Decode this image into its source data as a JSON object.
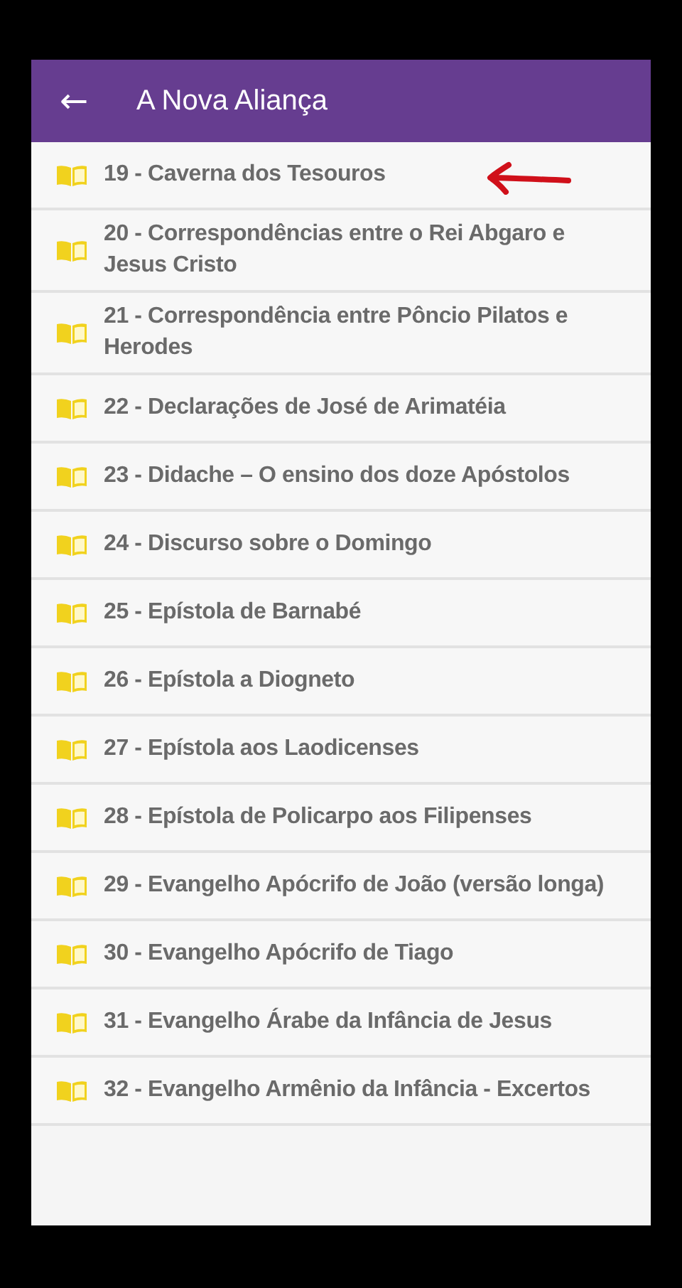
{
  "app_bar": {
    "back_icon": "←",
    "title": "A Nova Aliança"
  },
  "items": [
    {
      "label": "19 - Caverna dos Tesouros",
      "marked": true
    },
    {
      "label": "20 - Correspondências entre o Rei Abgaro e Jesus Cristo",
      "marked": false
    },
    {
      "label": "21 - Correspondência entre Pôncio Pilatos e Herodes",
      "marked": false
    },
    {
      "label": "22 - Declarações de José de Arimatéia",
      "marked": false
    },
    {
      "label": "23 - Didache – O ensino dos doze Apóstolos",
      "marked": false
    },
    {
      "label": "24 - Discurso sobre o Domingo",
      "marked": false
    },
    {
      "label": "25 - Epístola de Barnabé",
      "marked": false
    },
    {
      "label": "26 - Epístola a Diogneto",
      "marked": false
    },
    {
      "label": "27 - Epístola aos Laodicenses",
      "marked": false
    },
    {
      "label": "28 - Epístola de Policarpo aos Filipenses",
      "marked": false
    },
    {
      "label": "29 - Evangelho Apócrifo de João (versão longa)",
      "marked": false
    },
    {
      "label": "30 - Evangelho Apócrifo de Tiago",
      "marked": false
    },
    {
      "label": "31 - Evangelho Árabe da Infância de Jesus",
      "marked": false
    },
    {
      "label": "32 - Evangelho Armênio da Infância - Excertos",
      "marked": false
    }
  ]
}
